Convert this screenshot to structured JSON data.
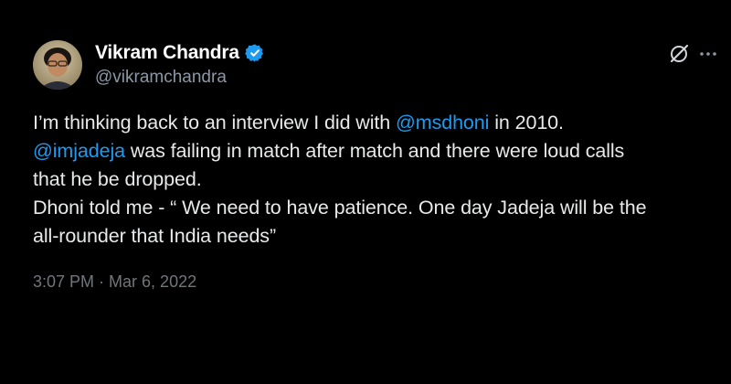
{
  "author": {
    "display_name": "Vikram Chandra",
    "handle": "@vikramchandra",
    "verified": true
  },
  "icons": {
    "avatar": "profile-avatar",
    "verified": "verified-badge-icon",
    "grok": "grok-icon",
    "more": "more-options-icon"
  },
  "tweet": {
    "line1_prefix": "I’m thinking back to an interview I did with ",
    "line1_mention": "@msdhoni",
    "line1_suffix": " in 2010.",
    "line2_mention": "@imjadeja",
    "line2_suffix": " was failing in match after match and there were loud calls",
    "line3": "that he be dropped.",
    "line4": "Dhoni told me - “ We need to have patience. One day Jadeja will be the",
    "line5": "all-rounder that India needs”"
  },
  "timestamp": {
    "time": "3:07 PM",
    "separator": "·",
    "date": "Mar 6, 2022"
  },
  "colors": {
    "background": "#000000",
    "text": "#e7e9ea",
    "mention": "#1d9bf0",
    "muted": "#71767b",
    "verified": "#1d9bf0"
  }
}
